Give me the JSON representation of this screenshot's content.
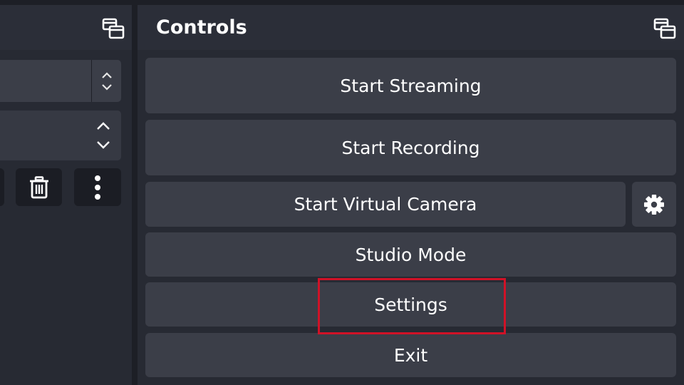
{
  "left_dock": {
    "undock_icon": "undock-icon",
    "combo_spin_icon": "chevron-updown-icon",
    "tools": [
      {
        "icon": "trash-icon"
      },
      {
        "icon": "more-vertical-icon"
      }
    ]
  },
  "controls": {
    "title": "Controls",
    "undock_icon": "undock-icon",
    "buttons": {
      "start_streaming": "Start Streaming",
      "start_recording": "Start Recording",
      "start_virtual_camera": "Start Virtual Camera",
      "virtual_camera_settings_icon": "gear-icon",
      "studio_mode": "Studio Mode",
      "settings": "Settings",
      "exit": "Exit"
    }
  },
  "colors": {
    "background": "#1d1f26",
    "dock": "#272a33",
    "titlebar": "#2b2e38",
    "button": "#3b3e48",
    "text": "#ffffff",
    "highlight": "#d01227"
  }
}
